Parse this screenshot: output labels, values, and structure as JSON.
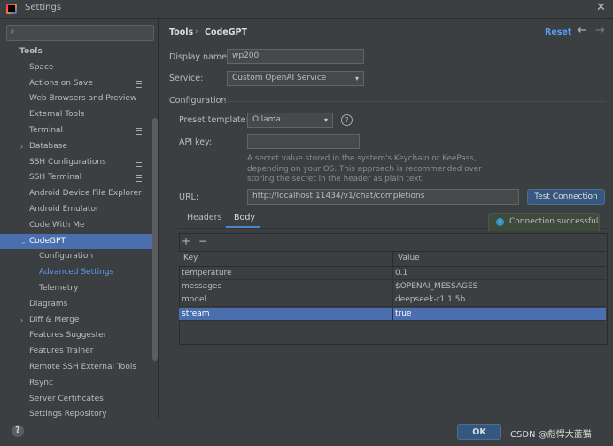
{
  "window": {
    "title": "Settings",
    "close": "✕"
  },
  "search": {
    "placeholder": ""
  },
  "sidebar": {
    "items": [
      {
        "label": "Tools",
        "type": "header"
      },
      {
        "label": "Space"
      },
      {
        "label": "Actions on Save",
        "indicator": true
      },
      {
        "label": "Web Browsers and Preview"
      },
      {
        "label": "External Tools"
      },
      {
        "label": "Terminal",
        "indicator": true
      },
      {
        "label": "Database",
        "arrow": "›"
      },
      {
        "label": "SSH Configurations",
        "indicator": true
      },
      {
        "label": "SSH Terminal",
        "indicator": true
      },
      {
        "label": "Android Device File Explorer"
      },
      {
        "label": "Android Emulator"
      },
      {
        "label": "Code With Me"
      },
      {
        "label": "CodeGPT",
        "arrow": "⌄",
        "selected": true
      },
      {
        "label": "Configuration",
        "sub": true
      },
      {
        "label": "Advanced Settings",
        "sub": true,
        "active": true
      },
      {
        "label": "Telemetry",
        "sub": true
      },
      {
        "label": "Diagrams"
      },
      {
        "label": "Diff & Merge",
        "arrow": "›"
      },
      {
        "label": "Features Suggester"
      },
      {
        "label": "Features Trainer"
      },
      {
        "label": "Remote SSH External Tools"
      },
      {
        "label": "Rsync"
      },
      {
        "label": "Server Certificates"
      },
      {
        "label": "Settings Repository"
      }
    ]
  },
  "header": {
    "breadcrumb": [
      "Tools",
      "CodeGPT"
    ],
    "separator": "›",
    "reset": "Reset",
    "back": "←",
    "forward": "→"
  },
  "form": {
    "display_name_label": "Display name:",
    "display_name_value": "wp200",
    "service_label": "Service:",
    "service_value": "Custom OpenAI Service",
    "configuration_title": "Configuration",
    "preset_label": "Preset template:",
    "preset_value": "Ollama",
    "api_key_label": "API key:",
    "api_key_value": "",
    "api_key_hint": "A secret value stored in the system's Keychain or KeePass, depending on your OS. This approach is recommended over storing the secret in the header as plain text.",
    "url_label": "URL:",
    "url_value": "http://localhost:11434/v1/chat/completions",
    "test_button": "Test Connection",
    "help": "?",
    "combo_arrow": "▾"
  },
  "tabs": [
    {
      "label": "Headers",
      "selected": false
    },
    {
      "label": "Body",
      "selected": true
    }
  ],
  "table": {
    "add": "+",
    "remove": "−",
    "columns": [
      "Key",
      "Value"
    ],
    "rows": [
      {
        "key": "temperature",
        "value": "0.1"
      },
      {
        "key": "messages",
        "value": "$OPENAI_MESSAGES"
      },
      {
        "key": "model",
        "value": "deepseek-r1:1.5b"
      },
      {
        "key": "stream",
        "value": "true",
        "selected": true
      }
    ]
  },
  "notification": {
    "icon": "i",
    "text": "Connection successful."
  },
  "footer": {
    "help": "?",
    "ok": "OK",
    "watermark": "CSDN @彪悍大蓝猫"
  },
  "colors": {
    "accent": "#4b6eaf",
    "link": "#589df6",
    "button": "#365880",
    "background": "#3c3f41"
  }
}
